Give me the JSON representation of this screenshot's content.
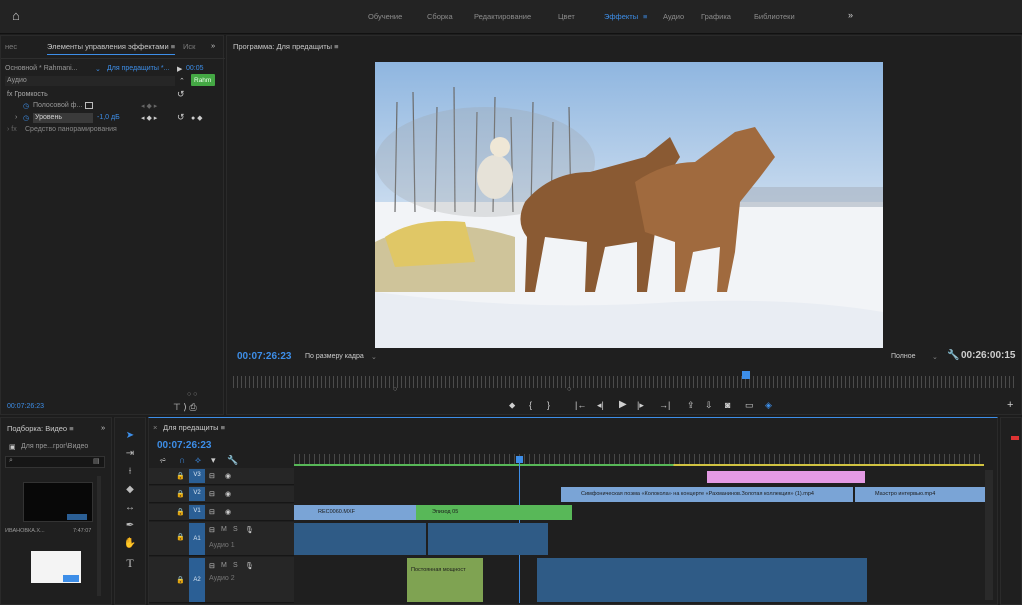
{
  "workspaces": [
    "Обучение",
    "Сборка",
    "Редактирование",
    "Цвет",
    "Эффекты",
    "Аудио",
    "Графика",
    "Библиотеки"
  ],
  "workspace_active": "Эффекты",
  "workspace_menu_glyph": "≡",
  "more_glyph": "»",
  "effects_panel": {
    "prev_tab": "нес",
    "title": "Элементы управления эффектами ≡",
    "next_tab": "Иск",
    "more": "»",
    "source": "Основной * Rahmani...",
    "sequence": "Для предащиты *...",
    "mini_tc": "00:05",
    "section": "Аудио",
    "clip_chip": "Rahm",
    "fx_group": "fx Громкость",
    "bypass": "Полосовой ф...",
    "level_label": "Уровень",
    "level_value": "-1,0 дБ",
    "panner": "Средство панорамирования",
    "timecode": "00:07:26:23"
  },
  "program": {
    "title": "Программа: Для предащиты ≡",
    "timecode": "00:07:26:23",
    "fit": "По размеру кадра",
    "quality": "Полное",
    "duration": "00:26:00:15",
    "icons": [
      "marker-icon",
      "mark-in-icon",
      "mark-out-icon",
      "go-to-in-icon",
      "step-back-icon",
      "play-icon",
      "step-forward-icon",
      "go-to-out-icon",
      "lift-icon",
      "extract-icon",
      "export-frame-icon",
      "compare-icon",
      "vr-icon"
    ]
  },
  "project": {
    "title": "Подборка: Видео ≡",
    "more": "»",
    "bin_path": "Для пре...грог\\Видео",
    "thumb1_label": "ИВАНОВКА.Х...",
    "thumb1_dur": "7:47:07"
  },
  "timeline": {
    "tab": "Для предащиты ≡",
    "timecode": "00:07:26:23",
    "tracks": [
      {
        "id": "V3",
        "name": ""
      },
      {
        "id": "V2",
        "name": ""
      },
      {
        "id": "V1",
        "name": ""
      },
      {
        "id": "A1",
        "name": "Аудио 1"
      },
      {
        "id": "A2",
        "name": "Аудио 2"
      }
    ],
    "clips": {
      "v1a": "REC0060.MXF",
      "v1b": "Эпизод 05",
      "v2a": "Симфоническая поэма «Колокола» на концерте «Рахманинов.Золотая коллекция» (1).mp4",
      "v2b": "Маэстро интервью.mp4",
      "a2a": "Постоянная мощност"
    }
  },
  "colors": {
    "accent": "#3d8ee8",
    "video_clip": "#7aa4d6",
    "green_clip": "#58b858",
    "pink_clip": "#e49ae4",
    "audio_clip": "#2f5b86"
  }
}
